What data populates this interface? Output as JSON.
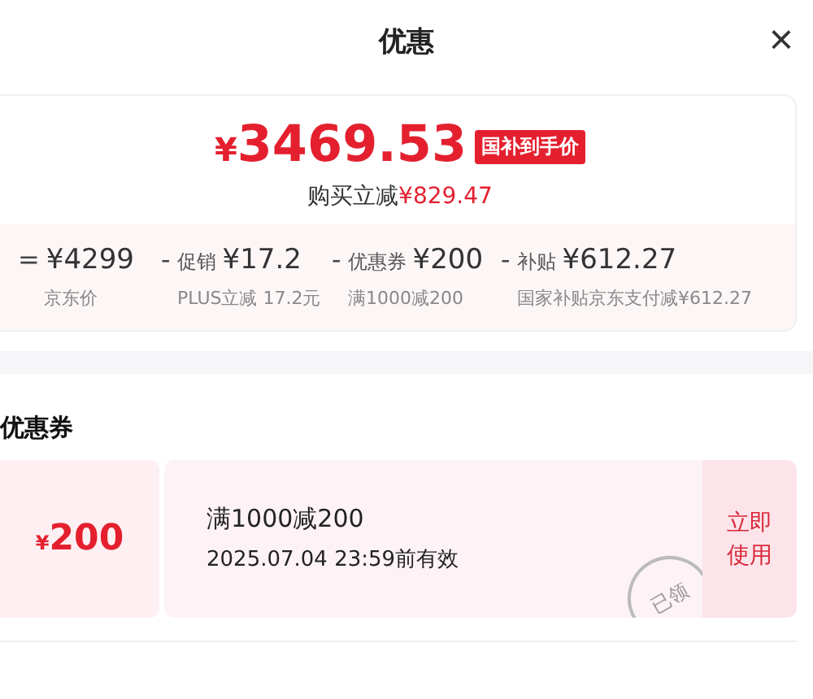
{
  "header": {
    "title": "优惠",
    "close": "×"
  },
  "summary": {
    "currency": "¥",
    "amount": "3469.53",
    "badge": "国补到手价",
    "saving_label": "购买立减",
    "saving_amount": "¥829.47",
    "breakdown": [
      {
        "operator": "=",
        "amount": "¥4299",
        "note": "京东价"
      },
      {
        "operator": "-",
        "label": "促销",
        "amount": "¥17.2",
        "note": "PLUS立减 17.2元"
      },
      {
        "operator": "-",
        "label": "优惠券",
        "amount": "¥200",
        "note": "满1000减200"
      },
      {
        "operator": "-",
        "label": "补贴",
        "amount": "¥612.27",
        "note": "国家补贴京东支付减¥612.27"
      }
    ]
  },
  "coupons_section": {
    "title": "优惠券",
    "coupons": [
      {
        "currency": "¥",
        "amount": "200",
        "title": "满1000减200",
        "validity": "2025.07.04 23:59前有效",
        "action": "立即使用",
        "stamp": "已领"
      }
    ]
  }
}
